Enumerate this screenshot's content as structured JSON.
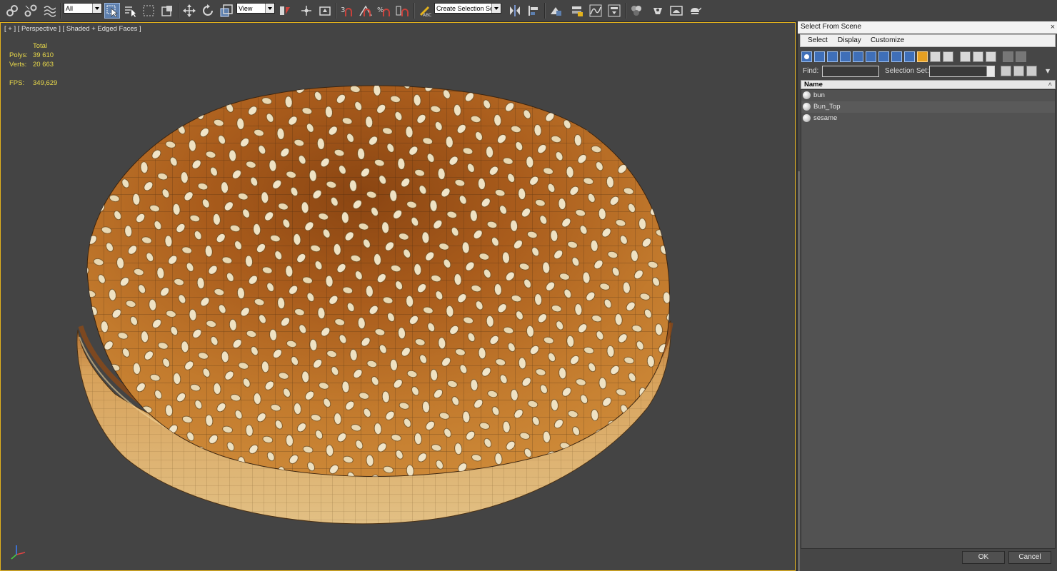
{
  "toolbar": {
    "filter_value": "All",
    "coord_value": "View",
    "selection_set_placeholder": "Create Selection Se"
  },
  "viewport": {
    "label": "[ + ] [ Perspective ] [ Shaded + Edged Faces ]",
    "stats": {
      "total_label": "Total",
      "polys_label": "Polys:",
      "polys_value": "39 610",
      "verts_label": "Verts:",
      "verts_value": "20 663",
      "fps_label": "FPS:",
      "fps_value": "349,629"
    }
  },
  "dialog": {
    "title": "Select From Scene",
    "close": "×",
    "menu": [
      "Select",
      "Display",
      "Customize"
    ],
    "find_label": "Find:",
    "find_value": "",
    "selection_set_label": "Selection Set:",
    "column_name": "Name",
    "objects": [
      "bun",
      "Bun_Top",
      "sesame"
    ],
    "ok_label": "OK",
    "cancel_label": "Cancel"
  },
  "colors": {
    "viewport_bg": "#444444",
    "active_border": "#e3b21c",
    "stats_text": "#e9d94a",
    "bun_crust": "#b2641c",
    "tool_active": "#5d7fae"
  }
}
